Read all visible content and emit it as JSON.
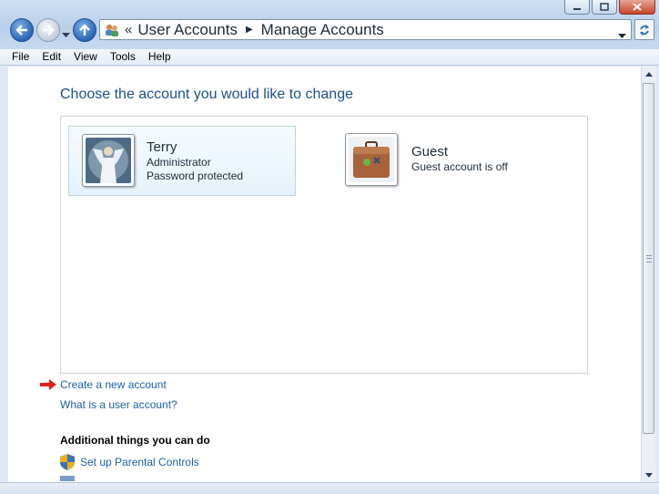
{
  "window": {
    "minimize_icon": "minimize-icon",
    "maximize_icon": "maximize-icon",
    "close_icon": "close-icon"
  },
  "address": {
    "overflow_marker": "«",
    "breadcrumbs": [
      "User Accounts",
      "Manage Accounts"
    ],
    "location_icon": "user-accounts-icon"
  },
  "menu": [
    "File",
    "Edit",
    "View",
    "Tools",
    "Help"
  ],
  "main": {
    "heading": "Choose the account you would like to change",
    "accounts": [
      {
        "name": "Terry",
        "lines": [
          "Administrator",
          "Password protected"
        ],
        "picture": "angel-picture"
      },
      {
        "name": "Guest",
        "lines": [
          "Guest account is off"
        ],
        "picture": "suitcase-picture"
      }
    ],
    "links": {
      "create": "Create a new account",
      "what_is": "What is a user account?"
    },
    "additional_heading": "Additional things you can do",
    "additional_items": [
      "Set up Parental Controls"
    ]
  },
  "colors": {
    "link": "#1e5fa8",
    "heading": "#1e4e8c",
    "arrow": "#e0201b"
  }
}
